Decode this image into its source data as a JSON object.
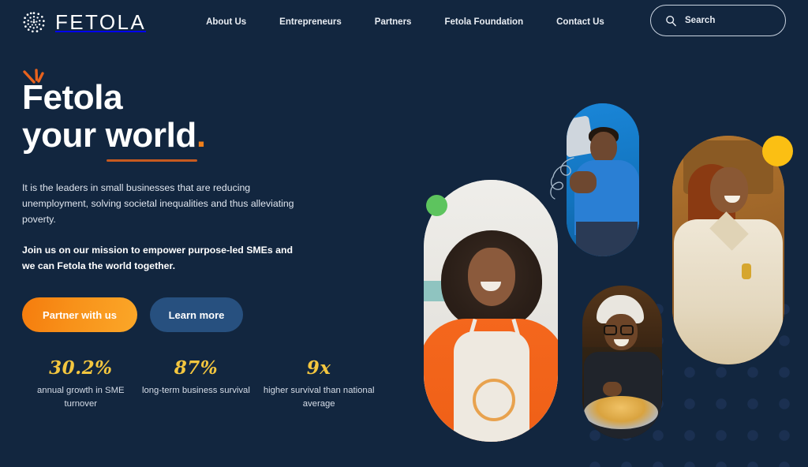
{
  "brand": {
    "name": "FETOLA",
    "logo_icon": "dot-circle-logo-icon"
  },
  "nav": {
    "items": [
      {
        "label": "About Us"
      },
      {
        "label": "Entrepreneurs"
      },
      {
        "label": "Partners"
      },
      {
        "label": "Fetola Foundation"
      },
      {
        "label": "Contact Us"
      }
    ]
  },
  "search": {
    "placeholder": "Search",
    "icon": "search-icon",
    "value": ""
  },
  "hero": {
    "headline_line1": "Fetola",
    "headline_line2_prefix": "your ",
    "headline_line2_underlined": "world",
    "headline_period": ".",
    "paragraph": "It is the leaders in small businesses that are reducing unemployment, solving societal inequalities and thus alleviating poverty.",
    "paragraph_bold": "Join us on our mission to empower purpose-led SMEs and we can Fetola the world together.",
    "buttons": {
      "primary": "Partner with us",
      "secondary": "Learn more"
    }
  },
  "stats": [
    {
      "value": "30.2%",
      "label": "annual growth in SME turnover"
    },
    {
      "value": "87%",
      "label": "long-term business survival"
    },
    {
      "value": "9x",
      "label": "higher survival than national average"
    }
  ],
  "colors": {
    "background": "#12263f",
    "accent_orange": "#f5821f",
    "underline_orange": "#c75a20",
    "stat_gold": "#f3c63f",
    "button_secondary_blue": "#27507f",
    "accent_green": "#5dc45e",
    "accent_yellow": "#fbbf13",
    "text_light": "#dfe5ee"
  },
  "decorations": {
    "burst": "orange-burst-icon",
    "squiggle": "squiggle-line-icon",
    "green_circle": "green-circle-accent",
    "yellow_circle": "yellow-circle-accent",
    "dot_field": "dot-pattern-decoration"
  },
  "photos": [
    {
      "name": "woman-orange-apron-photo"
    },
    {
      "name": "man-blue-shirt-photo"
    },
    {
      "name": "woman-cream-shirt-photo"
    },
    {
      "name": "chef-with-plate-photo"
    }
  ]
}
